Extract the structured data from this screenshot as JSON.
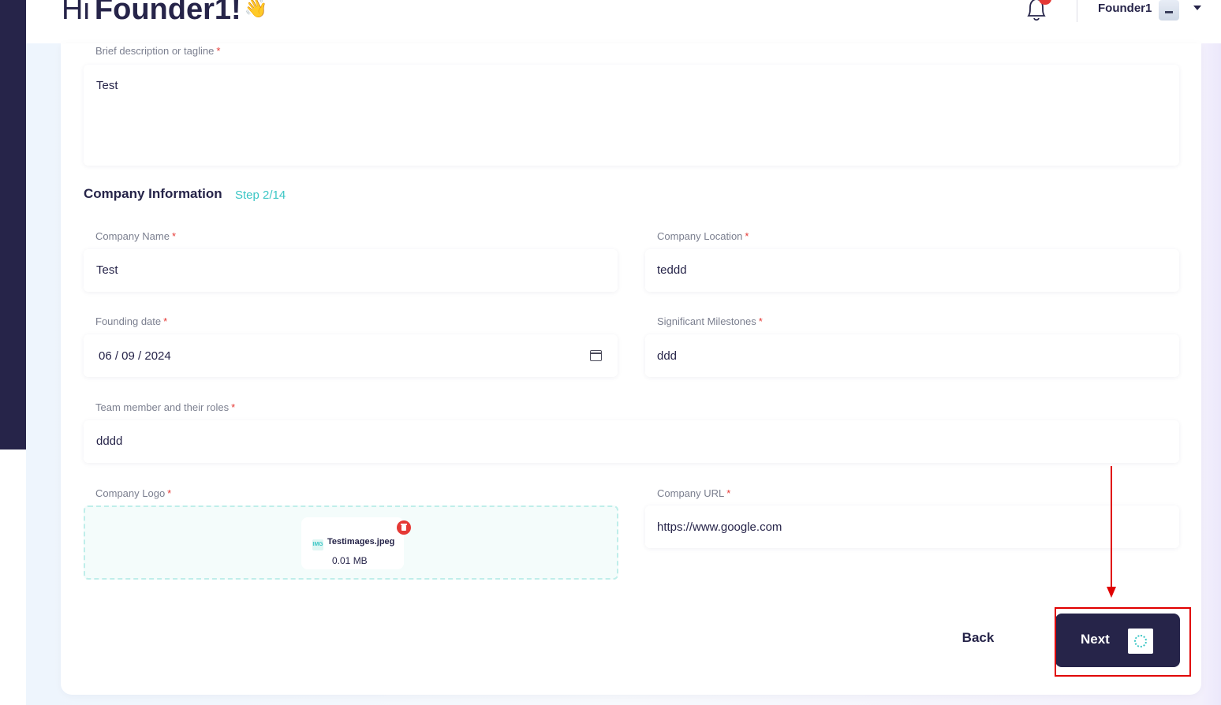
{
  "header": {
    "greeting_prefix": "Hi",
    "greeting_name": "Founder1!",
    "wave_emoji": "👋",
    "user_name": "Founder1",
    "icons": {
      "bell": "bell-icon",
      "caret": "chevron-down-icon"
    }
  },
  "form": {
    "tagline": {
      "label": "Brief description or tagline",
      "required": "*",
      "value": "Test"
    },
    "section": {
      "title": "Company Information",
      "step": "Step 2/14"
    },
    "company_name": {
      "label": "Company Name",
      "required": "*",
      "value": "Test"
    },
    "company_location": {
      "label": "Company Location",
      "required": "*",
      "value": "teddd"
    },
    "founding_date": {
      "label": "Founding date",
      "required": "*",
      "value": "06 / 09 / 2024"
    },
    "milestones": {
      "label": "Significant Milestones",
      "required": "*",
      "value": "ddd"
    },
    "team": {
      "label": "Team member and their roles",
      "required": "*",
      "value": "dddd"
    },
    "logo": {
      "label": "Company Logo",
      "required": "*",
      "file_name": "Testimages.jpeg",
      "file_size": "0.01 MB",
      "file_type": "IMG"
    },
    "company_url": {
      "label": "Company URL",
      "required": "*",
      "value": "https://www.google.com"
    }
  },
  "actions": {
    "back_label": "Back",
    "next_label": "Next"
  },
  "colors": {
    "navy": "#262449",
    "teal": "#3bc6c5",
    "required_red": "#e53935",
    "annotation_red": "#e00000"
  }
}
